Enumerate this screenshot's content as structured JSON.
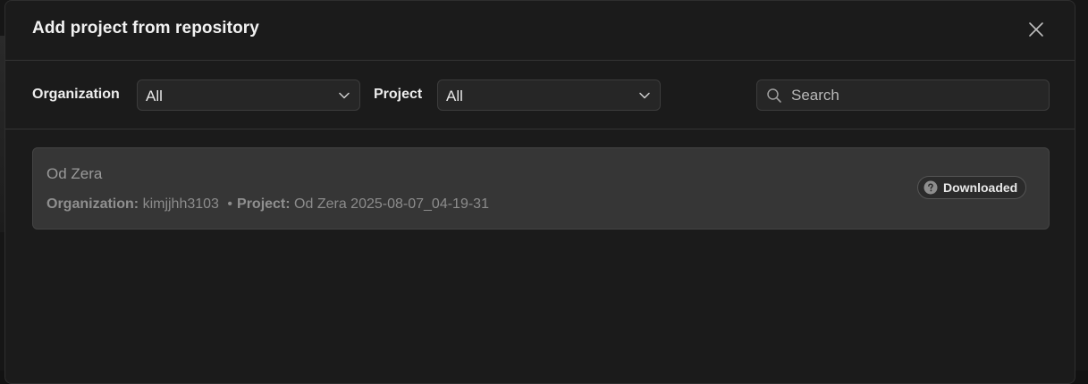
{
  "dialog": {
    "title": "Add project from repository",
    "close_icon": "close-icon"
  },
  "filters": {
    "organization": {
      "label": "Organization",
      "selected": "All"
    },
    "project": {
      "label": "Project",
      "selected": "All"
    },
    "search": {
      "placeholder": "Search",
      "value": ""
    }
  },
  "results": [
    {
      "name": "Od Zera",
      "organization_label": "Organization:",
      "organization": "kimjjhh3103",
      "separator": "•",
      "project_label": "Project:",
      "project": "Od Zera 2025-08-07_04-19-31",
      "status": "Downloaded",
      "status_icon": "question-circle-icon"
    }
  ],
  "colors": {
    "background": "#1b1b1b",
    "card": "#363636",
    "text_primary": "#f2f2f2",
    "text_muted": "#8c8c8c"
  }
}
